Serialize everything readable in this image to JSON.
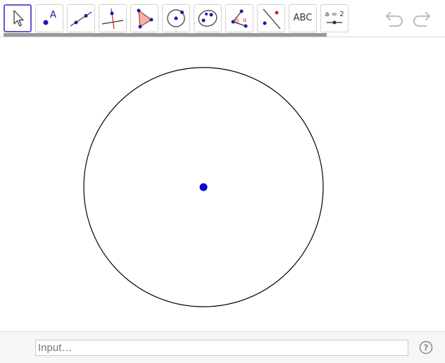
{
  "toolbar": {
    "tools": [
      {
        "name": "move",
        "icon": "move-arrow-icon"
      },
      {
        "name": "point",
        "icon": "point-icon",
        "label": "A"
      },
      {
        "name": "line",
        "icon": "line-icon"
      },
      {
        "name": "perpendicular-line",
        "icon": "perpendicular-line-icon"
      },
      {
        "name": "polygon",
        "icon": "polygon-icon"
      },
      {
        "name": "circle-center-point",
        "icon": "circle-icon"
      },
      {
        "name": "ellipse",
        "icon": "conic-icon"
      },
      {
        "name": "angle",
        "icon": "angle-icon",
        "label": "α"
      },
      {
        "name": "reflect",
        "icon": "reflect-icon"
      },
      {
        "name": "text",
        "icon": "text-icon",
        "label": "ABC"
      },
      {
        "name": "slider",
        "icon": "slider-icon",
        "label": "a = 2"
      }
    ],
    "selected_tool": "move",
    "undo_icon": "undo-icon",
    "redo_icon": "redo-icon"
  },
  "graphics": {
    "objects": [
      {
        "type": "circle",
        "color": "#000000"
      },
      {
        "type": "point",
        "color": "#0000ff"
      }
    ],
    "accent": "#6557d2"
  },
  "input_bar": {
    "placeholder": "Input…",
    "value": "",
    "help_icon": "help-icon"
  }
}
